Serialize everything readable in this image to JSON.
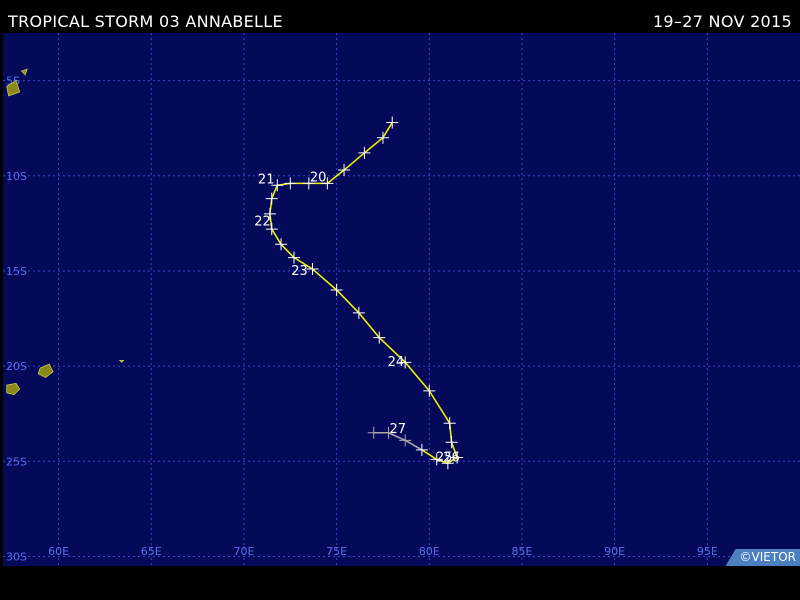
{
  "header": {
    "storm_title": "TROPICAL STORM 03 ANNABELLE",
    "date_range": "19–27 NOV 2015"
  },
  "credit": "©VIETOR",
  "map": {
    "lon_range": [
      57,
      100
    ],
    "lat_range": [
      -30.5,
      -2.5
    ],
    "lon_grid": [
      {
        "lon": 60,
        "label": "60E"
      },
      {
        "lon": 65,
        "label": "65E"
      },
      {
        "lon": 70,
        "label": "70E"
      },
      {
        "lon": 75,
        "label": "75E"
      },
      {
        "lon": 80,
        "label": "80E"
      },
      {
        "lon": 85,
        "label": "85E"
      },
      {
        "lon": 90,
        "label": "90E"
      },
      {
        "lon": 95,
        "label": "95E"
      }
    ],
    "lat_grid": [
      {
        "lat": -5,
        "label": "5S"
      },
      {
        "lat": -10,
        "label": "10S"
      },
      {
        "lat": -15,
        "label": "15S"
      },
      {
        "lat": -20,
        "label": "20S"
      },
      {
        "lat": -25,
        "label": "25S"
      },
      {
        "lat": -30,
        "label": "30S"
      }
    ],
    "colors": {
      "ocean": "#05095a",
      "grid": "#3c46c8",
      "grid_label": "#5a6ee6",
      "track_storm": "#f0f000",
      "track_weak": "#a8a8a8",
      "land": "#8a8a1a"
    },
    "track": [
      {
        "lon": 78.0,
        "lat": -7.2,
        "type": "storm"
      },
      {
        "lon": 77.5,
        "lat": -8.0,
        "type": "storm"
      },
      {
        "lon": 76.5,
        "lat": -8.8,
        "type": "storm"
      },
      {
        "lon": 75.4,
        "lat": -9.7,
        "type": "storm"
      },
      {
        "lon": 74.5,
        "lat": -10.4,
        "type": "storm"
      },
      {
        "lon": 73.5,
        "lat": -10.4,
        "type": "storm"
      },
      {
        "lon": 72.5,
        "lat": -10.4,
        "type": "storm"
      },
      {
        "lon": 71.8,
        "lat": -10.5,
        "type": "storm"
      },
      {
        "lon": 71.5,
        "lat": -11.2,
        "type": "storm"
      },
      {
        "lon": 71.4,
        "lat": -12.0,
        "type": "storm"
      },
      {
        "lon": 71.5,
        "lat": -12.8,
        "type": "storm"
      },
      {
        "lon": 72.0,
        "lat": -13.6,
        "type": "storm"
      },
      {
        "lon": 72.7,
        "lat": -14.3,
        "type": "storm"
      },
      {
        "lon": 73.7,
        "lat": -14.9,
        "type": "storm"
      },
      {
        "lon": 75.0,
        "lat": -16.0,
        "type": "storm"
      },
      {
        "lon": 76.2,
        "lat": -17.2,
        "type": "storm"
      },
      {
        "lon": 77.3,
        "lat": -18.5,
        "type": "storm"
      },
      {
        "lon": 78.7,
        "lat": -19.8,
        "type": "storm"
      },
      {
        "lon": 80.0,
        "lat": -21.3,
        "type": "storm"
      },
      {
        "lon": 81.1,
        "lat": -23.0,
        "type": "storm"
      },
      {
        "lon": 81.2,
        "lat": -24.0,
        "type": "storm"
      },
      {
        "lon": 81.5,
        "lat": -24.8,
        "type": "storm"
      },
      {
        "lon": 81.0,
        "lat": -25.1,
        "type": "storm"
      },
      {
        "lon": 80.4,
        "lat": -24.9,
        "type": "storm"
      },
      {
        "lon": 79.6,
        "lat": -24.4,
        "type": "storm"
      },
      {
        "lon": 78.7,
        "lat": -23.9,
        "type": "weak"
      },
      {
        "lon": 77.8,
        "lat": -23.5,
        "type": "weak"
      },
      {
        "lon": 77.0,
        "lat": -23.5,
        "type": "weak"
      }
    ],
    "day_labels": [
      {
        "text": "20",
        "lon": 74.0,
        "lat": -10.3
      },
      {
        "text": "21",
        "lon": 71.2,
        "lat": -10.4
      },
      {
        "text": "22",
        "lon": 71.0,
        "lat": -12.6
      },
      {
        "text": "23",
        "lon": 73.0,
        "lat": -15.2
      },
      {
        "text": "24",
        "lon": 78.2,
        "lat": -20.0
      },
      {
        "text": "25",
        "lon": 80.8,
        "lat": -25.0
      },
      {
        "text": "26",
        "lon": 81.2,
        "lat": -25.0
      },
      {
        "text": "27",
        "lon": 78.3,
        "lat": -23.5
      }
    ],
    "land": [
      {
        "name": "island-near-60e-6s",
        "points": [
          [
            57.2,
            -5.3
          ],
          [
            57.7,
            -5.0
          ],
          [
            57.9,
            -5.6
          ],
          [
            57.3,
            -5.8
          ]
        ]
      },
      {
        "name": "island-near-60e-5s",
        "points": [
          [
            58.0,
            -4.5
          ],
          [
            58.3,
            -4.4
          ],
          [
            58.2,
            -4.7
          ]
        ]
      },
      {
        "name": "mauritius",
        "points": [
          [
            59.0,
            -20.1
          ],
          [
            59.5,
            -19.9
          ],
          [
            59.7,
            -20.3
          ],
          [
            59.3,
            -20.6
          ],
          [
            58.9,
            -20.4
          ]
        ]
      },
      {
        "name": "reunion",
        "points": [
          [
            57.2,
            -21.0
          ],
          [
            57.7,
            -20.9
          ],
          [
            57.9,
            -21.2
          ],
          [
            57.6,
            -21.5
          ],
          [
            57.2,
            -21.4
          ]
        ]
      },
      {
        "name": "rodrigues",
        "points": [
          [
            63.3,
            -19.7
          ],
          [
            63.5,
            -19.7
          ],
          [
            63.4,
            -19.8
          ]
        ]
      }
    ]
  }
}
